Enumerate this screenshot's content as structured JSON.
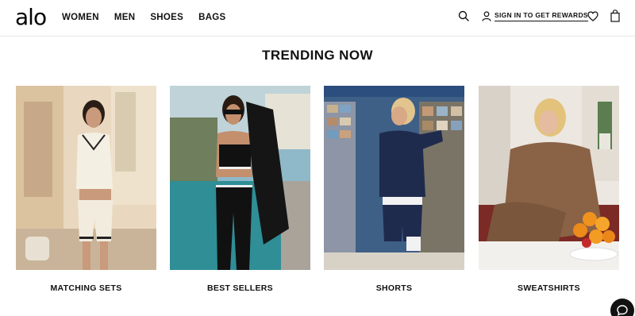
{
  "header": {
    "logo": "alo",
    "nav": [
      "WOMEN",
      "MEN",
      "SHOES",
      "BAGS"
    ],
    "signin_label": "SIGN IN TO GET REWARDS"
  },
  "section": {
    "title": "TRENDING NOW",
    "categories": [
      {
        "label": "MATCHING SETS",
        "photo_desc": "woman in cream knit polo and shorts on a street"
      },
      {
        "label": "BEST SELLERS",
        "photo_desc": "woman in black sports bra and leggings by the sea"
      },
      {
        "label": "SHORTS",
        "photo_desc": "woman in navy sweatshirt and shorts at a postcard stand"
      },
      {
        "label": "SWEATSHIRTS",
        "photo_desc": "woman in brown sweatshirt seated at a table with oranges"
      }
    ]
  },
  "colors": {
    "text": "#111111",
    "border": "#e6e6e6",
    "background": "#ffffff"
  },
  "icons": [
    "search-icon",
    "user-icon",
    "heart-icon",
    "bag-icon",
    "chat-icon"
  ]
}
